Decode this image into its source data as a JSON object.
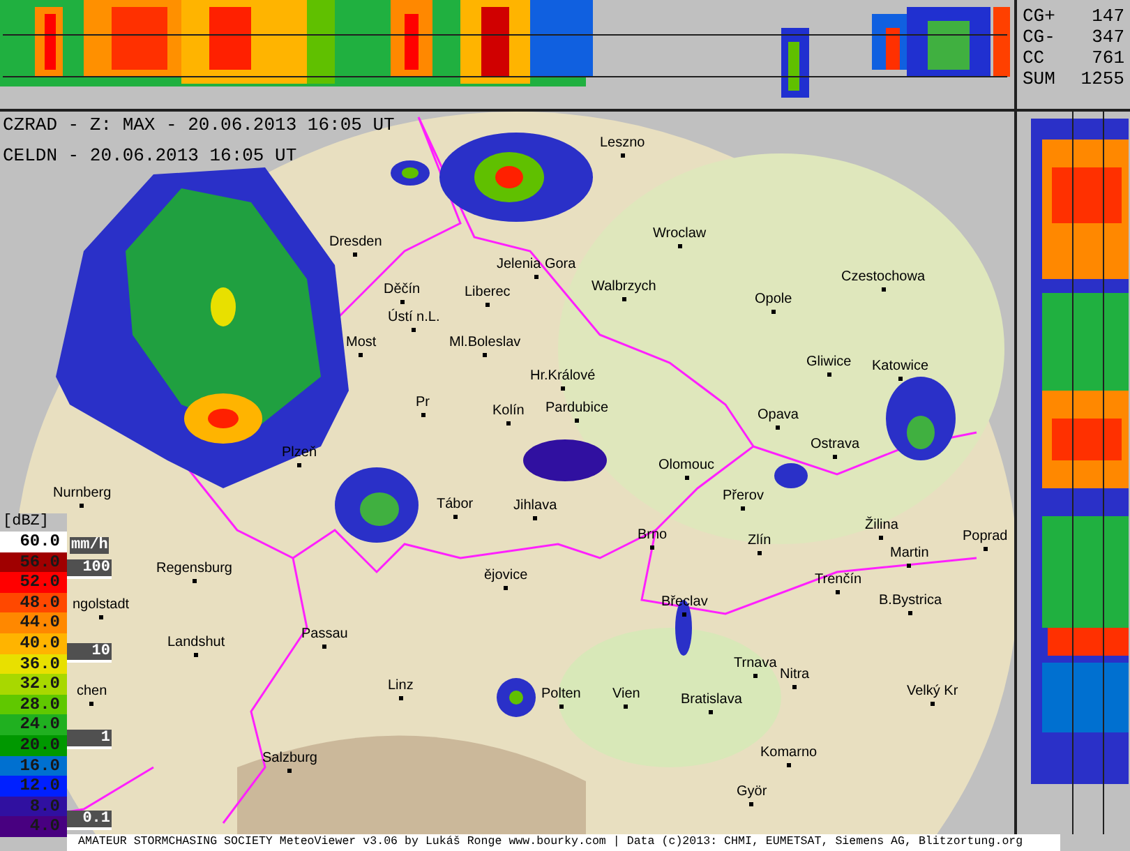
{
  "header": {
    "lines": [
      "CZRAD - Z: MAX - 20.06.2013 16:05 UT",
      "CELDN - 20.06.2013 16:05 UT"
    ]
  },
  "lightning_stats": [
    {
      "label": "CG+",
      "value": "147"
    },
    {
      "label": "CG-",
      "value": "347"
    },
    {
      "label": "CC",
      "value": "761"
    },
    {
      "label": "SUM",
      "value": "1255"
    }
  ],
  "legend": {
    "unit": "[dBZ]",
    "rain_unit": "mm/h",
    "rain_marks": [
      "100",
      "10",
      "1",
      "0.1"
    ],
    "levels": [
      {
        "value": "60.0",
        "color": "#ffffff"
      },
      {
        "value": "56.0",
        "color": "#a00000"
      },
      {
        "value": "52.0",
        "color": "#ff0000"
      },
      {
        "value": "48.0",
        "color": "#ff4800"
      },
      {
        "value": "44.0",
        "color": "#ff8800"
      },
      {
        "value": "40.0",
        "color": "#ffb400"
      },
      {
        "value": "36.0",
        "color": "#e8e000"
      },
      {
        "value": "32.0",
        "color": "#a8d800"
      },
      {
        "value": "28.0",
        "color": "#60c800"
      },
      {
        "value": "24.0",
        "color": "#20b020"
      },
      {
        "value": "20.0",
        "color": "#009800"
      },
      {
        "value": "16.0",
        "color": "#0070d0"
      },
      {
        "value": "12.0",
        "color": "#0020ff"
      },
      {
        "value": "8.0",
        "color": "#3010a0"
      },
      {
        "value": "4.0",
        "color": "#480080"
      }
    ]
  },
  "map": {
    "cities": [
      "Leszno",
      "Dresden",
      "Wroclaw",
      "Jelenia Gora",
      "Czestochowa",
      "Děčín",
      "Liberec",
      "Walbrzych",
      "Opole",
      "Ústí n.L.",
      "Most",
      "Ml.Boleslav",
      "Hr.Králové",
      "Gliwice",
      "Katowice",
      "Pr",
      "Kolín",
      "Pardubice",
      "Opava",
      "Ostrava",
      "Plzeň",
      "Olomouc",
      "Nurnberg",
      "Přerov",
      "Tábor",
      "Jihlava",
      "Žilina",
      "Brno",
      "Zlín",
      "Poprad",
      "Martin",
      "Regensburg",
      "ějovice",
      "Trenčín",
      "ngolstadt",
      "Břeclav",
      "B.Bystrica",
      "Landshut",
      "Passau",
      "Trnava",
      "Nitra",
      "chen",
      "Linz",
      "Polten",
      "Vien",
      "Bratislava",
      "Velký Kr",
      "Komarno",
      "Salzburg",
      "Györ"
    ]
  },
  "footer": {
    "credits": "AMATEUR STORMCHASING SOCIETY MeteoViewer v3.06 by Lukáš Ronge www.bourky.com | Data (c)2013: CHMI, EUMETSAT, Siemens AG, Blitzortung.org"
  }
}
